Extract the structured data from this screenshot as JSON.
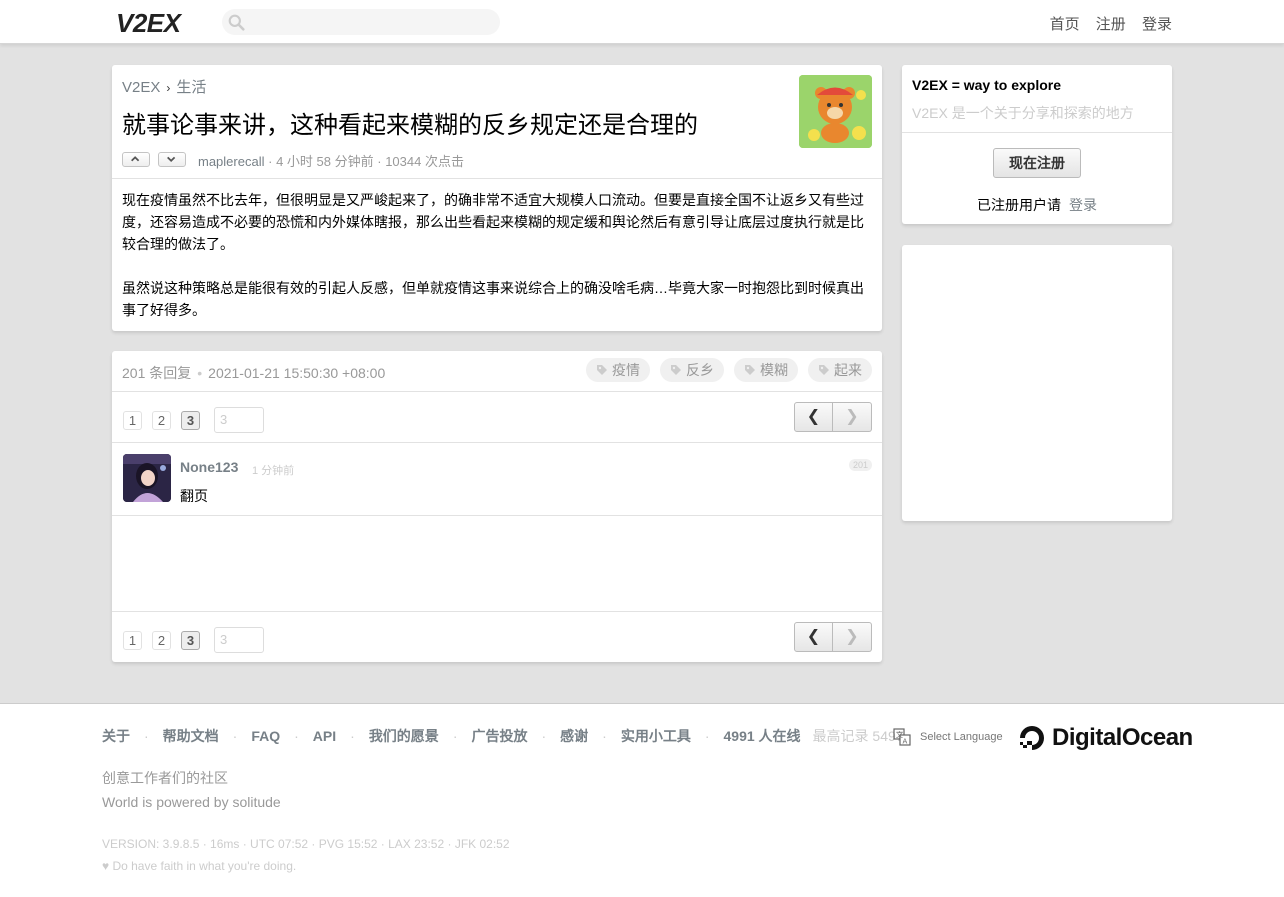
{
  "header": {
    "logo": "V2EX",
    "search_placeholder": "",
    "nav": [
      "首页",
      "注册",
      "登录"
    ]
  },
  "topic": {
    "breadcrumb_root": "V2EX",
    "breadcrumb_sep": "›",
    "breadcrumb_node": "生活",
    "title": "就事论事来讲，这种看起来模糊的反乡规定还是合理的",
    "author": "maplerecall",
    "time": "4 小时 58 分钟前",
    "clicks": "10344 次点击",
    "meta_sep": "·",
    "paragraphs": [
      "现在疫情虽然不比去年，但很明显是又严峻起来了，的确非常不适宜大规模人口流动。但要是直接全国不让返乡又有些过度，还容易造成不必要的恐慌和内外媒体瞎报，那么出些看起来模糊的规定缓和舆论然后有意引导让底层过度执行就是比较合理的做法了。",
      "虽然说这种策略总是能很有效的引起人反感，但单就疫情这事来说综合上的确没啥毛病…毕竟大家一时抱怨比到时候真出事了好得多。"
    ]
  },
  "replies": {
    "count": "201 条回复",
    "dot": "•",
    "datetime": "2021-01-21 15:50:30 +08:00",
    "tags": [
      "疫情",
      "反乡",
      "模糊",
      "起来"
    ],
    "pages": [
      "1",
      "2",
      "3"
    ],
    "current_page": "3",
    "jump_placeholder": "3",
    "prev_label": "❮",
    "next_label": "❯",
    "items": [
      {
        "user": "None123",
        "time": "1 分钟前",
        "no": "201",
        "text": "翻页"
      }
    ]
  },
  "sidebar": {
    "title": "V2EX = way to explore",
    "subtitle": "V2EX 是一个关于分享和探索的地方",
    "register_button": "现在注册",
    "login_prompt": "已注册用户请",
    "login_link": "登录"
  },
  "footer": {
    "links": [
      "关于",
      "帮助文档",
      "FAQ",
      "API",
      "我们的愿景",
      "广告投放",
      "感谢",
      "实用小工具",
      "4991 人在线"
    ],
    "link_sep": "·",
    "record": "最高记录 5497",
    "language": "Select Language",
    "sponsor": "DigitalOcean",
    "slogan1": "创意工作者们的社区",
    "slogan2": "World is powered by solitude",
    "version": "VERSION: 3.9.8.5 · 16ms · UTC 07:52 · PVG 15:52 · LAX 23:52 · JFK 02:52",
    "faith": "♥ Do have faith in what you're doing."
  },
  "colors": {
    "background": "#e2e2e2",
    "link": "#778087",
    "muted": "#999999",
    "faint": "#cccccc"
  }
}
